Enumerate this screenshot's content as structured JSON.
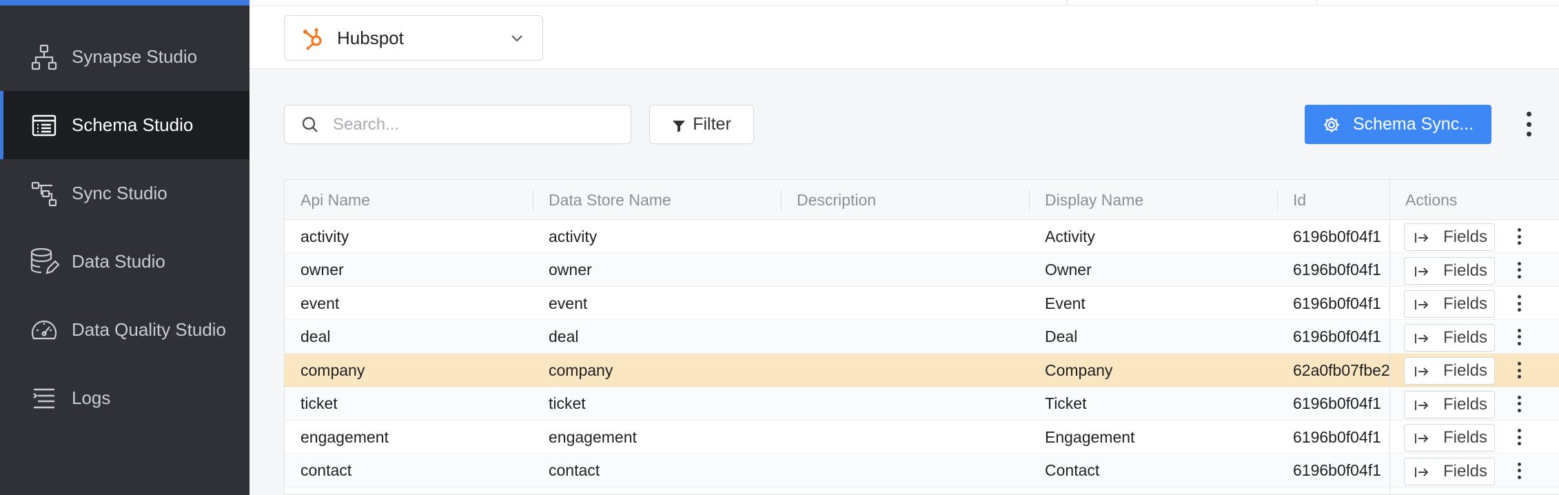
{
  "sidebar": {
    "items": [
      {
        "label": "Synapse Studio",
        "icon": "hierarchy-icon",
        "active": false
      },
      {
        "label": "Schema Studio",
        "icon": "list-icon",
        "active": true
      },
      {
        "label": "Sync Studio",
        "icon": "flow-icon",
        "active": false
      },
      {
        "label": "Data Studio",
        "icon": "database-edit-icon",
        "active": false
      },
      {
        "label": "Data Quality Studio",
        "icon": "gauge-icon",
        "active": false
      },
      {
        "label": "Logs",
        "icon": "logs-icon",
        "active": false
      }
    ]
  },
  "source": {
    "label": "Hubspot",
    "logo": "hubspot-logo-icon"
  },
  "toolbar": {
    "search_placeholder": "Search...",
    "filter_label": "Filter",
    "schema_sync_label": "Schema Sync..."
  },
  "table": {
    "columns": [
      "Api Name",
      "Data Store Name",
      "Description",
      "Display Name",
      "Id",
      "Actions"
    ],
    "fields_label": "Fields",
    "rows": [
      {
        "api_name": "activity",
        "data_store_name": "activity",
        "description": "",
        "display_name": "Activity",
        "id": "6196b0f04f1",
        "selected": false
      },
      {
        "api_name": "owner",
        "data_store_name": "owner",
        "description": "",
        "display_name": "Owner",
        "id": "6196b0f04f1",
        "selected": false
      },
      {
        "api_name": "event",
        "data_store_name": "event",
        "description": "",
        "display_name": "Event",
        "id": "6196b0f04f1",
        "selected": false
      },
      {
        "api_name": "deal",
        "data_store_name": "deal",
        "description": "",
        "display_name": "Deal",
        "id": "6196b0f04f1",
        "selected": false
      },
      {
        "api_name": "company",
        "data_store_name": "company",
        "description": "",
        "display_name": "Company",
        "id": "62a0fb07fbe2",
        "selected": true
      },
      {
        "api_name": "ticket",
        "data_store_name": "ticket",
        "description": "",
        "display_name": "Ticket",
        "id": "6196b0f04f1",
        "selected": false
      },
      {
        "api_name": "engagement",
        "data_store_name": "engagement",
        "description": "",
        "display_name": "Engagement",
        "id": "6196b0f04f1",
        "selected": false
      },
      {
        "api_name": "contact",
        "data_store_name": "contact",
        "description": "",
        "display_name": "Contact",
        "id": "6196b0f04f1",
        "selected": false
      }
    ]
  },
  "colors": {
    "sidebar_bg": "#2f3136",
    "sidebar_active_bg": "#1c1d21",
    "accent": "#3d7be0",
    "primary_button": "#3d88f5",
    "selected_row": "#fbe6c2",
    "hubspot_orange": "#f57722"
  }
}
